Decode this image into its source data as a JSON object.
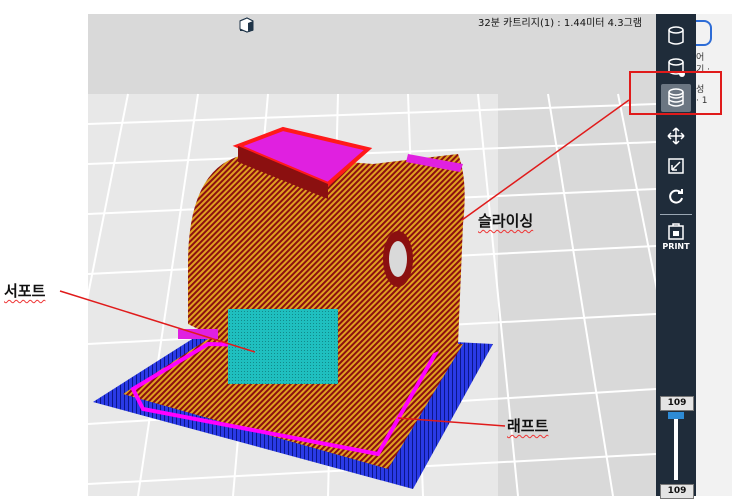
{
  "status": {
    "text": "32분  카트리지(1) : 1.44미터 4.3그램"
  },
  "toolbar": {
    "print_label": "PRINT",
    "slider_top": "109",
    "slider_bottom": "109"
  },
  "side_panel": {
    "line1": "어",
    "line2": "기 ·",
    "line3": "성",
    "line4": "· 1"
  },
  "annotations": {
    "slicing": "슬라이싱",
    "support": "서포트",
    "raft": "래프트"
  },
  "colors": {
    "toolbar_bg": "#1f2c3a",
    "active_btn": "#6b7682",
    "callout_line": "#e01b1b",
    "model_wall": "#8b1010",
    "model_infill": "#e0a020",
    "support": "#1fbfbf",
    "raft": "#1b2bd6",
    "top_layer": "#e020e0"
  },
  "icons": [
    "view-iso-icon",
    "view-front-icon",
    "view-top-icon",
    "view-side-icon",
    "view-right-icon",
    "cartridge-icon",
    "cartridge-load-icon",
    "layers-icon",
    "move-icon",
    "scale-icon",
    "rotate-icon",
    "print-icon"
  ]
}
